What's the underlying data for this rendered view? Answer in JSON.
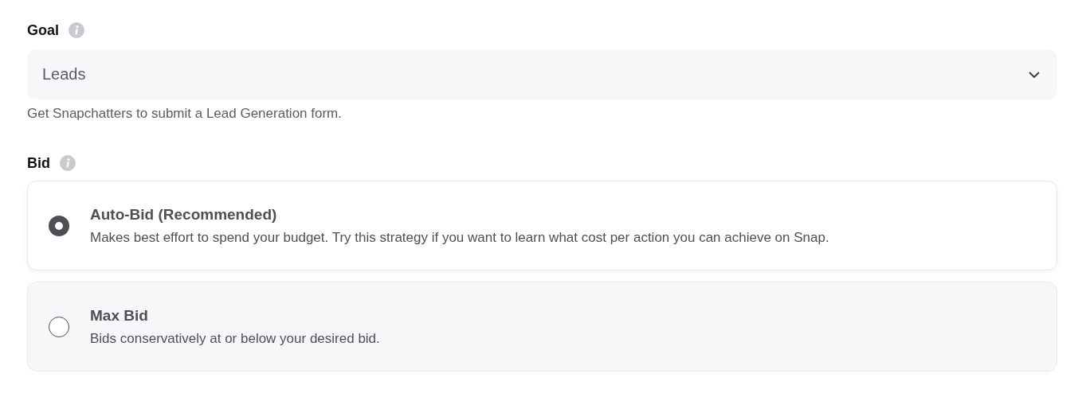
{
  "goal": {
    "label": "Goal",
    "value": "Leads",
    "help": "Get Snapchatters to submit a Lead Generation form."
  },
  "bid": {
    "label": "Bid",
    "options": [
      {
        "title": "Auto-Bid (Recommended)",
        "description": "Makes best effort to spend your budget. Try this strategy if you want to learn what cost per action you can achieve on Snap.",
        "selected": true
      },
      {
        "title": "Max Bid",
        "description": "Bids conservatively at or below your desired bid.",
        "selected": false
      }
    ]
  }
}
